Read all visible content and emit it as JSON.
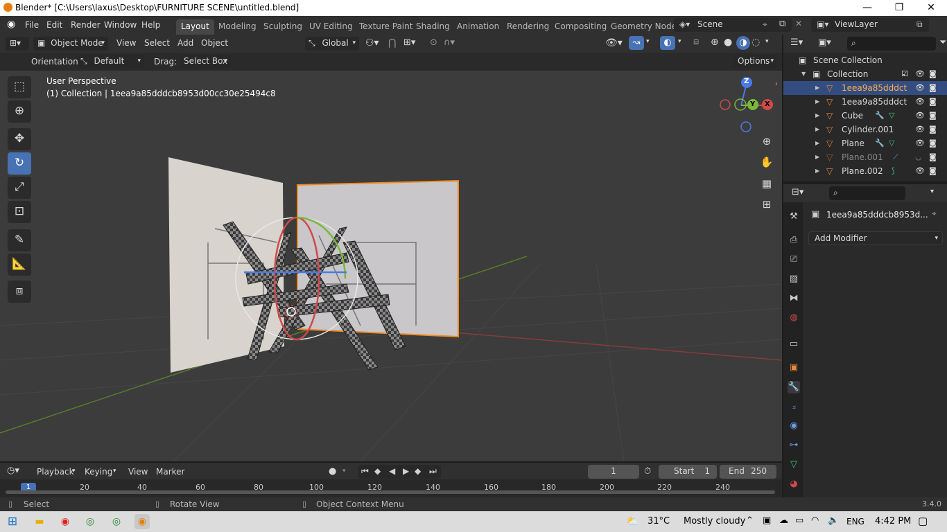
{
  "window": {
    "title": "Blender* [C:\\Users\\laxus\\Desktop\\FURNITURE SCENE\\untitled.blend]",
    "minimize": "—",
    "maximize": "❐",
    "close": "✕"
  },
  "menu": {
    "items": [
      "File",
      "Edit",
      "Render",
      "Window",
      "Help"
    ]
  },
  "workspaces": [
    "Layout",
    "Modeling",
    "Sculpting",
    "UV Editing",
    "Texture Paint",
    "Shading",
    "Animation",
    "Rendering",
    "Compositing",
    "Geometry Node"
  ],
  "scene": {
    "name": "Scene",
    "view_layer": "ViewLayer"
  },
  "viewport_header": {
    "mode": "Object Mode",
    "view": "View",
    "select": "Select",
    "add": "Add",
    "object": "Object",
    "transform": "Global"
  },
  "tool_header": {
    "orientation_label": "Orientation:",
    "orientation_value": "Default",
    "drag_label": "Drag:",
    "drag_value": "Select Box",
    "options": "Options"
  },
  "viewport": {
    "perspective": "User Perspective",
    "collection_info": "(1) Collection | 1eea9a85dddcb8953d00cc30e25494c8"
  },
  "gizmo": {
    "z": "Z",
    "y": "Y",
    "x": "X"
  },
  "outliner": {
    "root": "Scene Collection",
    "collection": "Collection",
    "items": [
      {
        "name": "1eea9a85dddct",
        "selected": true
      },
      {
        "name": "1eea9a85dddct",
        "selected": false
      },
      {
        "name": "Cube",
        "selected": false
      },
      {
        "name": "Cylinder.001",
        "selected": false
      },
      {
        "name": "Plane",
        "selected": false
      },
      {
        "name": "Plane.001",
        "selected": false
      },
      {
        "name": "Plane.002",
        "selected": false
      }
    ]
  },
  "properties": {
    "object_name": "1eea9a85dddcb8953d...",
    "add_modifier": "Add Modifier"
  },
  "timeline": {
    "playback": "Playback",
    "keying": "Keying",
    "view": "View",
    "marker": "Marker",
    "current_frame": "1",
    "start_label": "Start",
    "start": "1",
    "end_label": "End",
    "end": "250",
    "ruler": [
      "1",
      "20",
      "40",
      "60",
      "80",
      "100",
      "120",
      "140",
      "160",
      "180",
      "200",
      "220",
      "240"
    ]
  },
  "status": {
    "select": "Select",
    "rotate": "Rotate View",
    "context": "Object Context Menu",
    "version": "3.4.0"
  },
  "taskbar": {
    "temp": "31°C",
    "weather": "Mostly cloudy",
    "lang": "ENG",
    "time": "4:42 PM"
  }
}
